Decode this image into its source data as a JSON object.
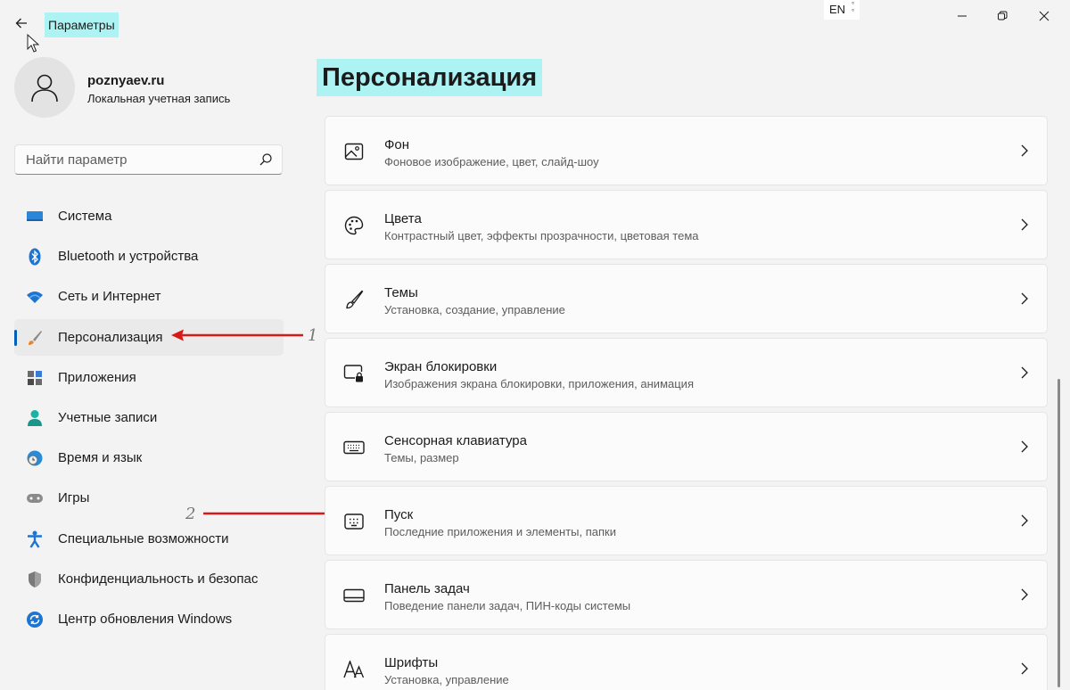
{
  "window": {
    "app_title": "Параметры",
    "lang_indicator": "EN"
  },
  "user": {
    "name": "poznyaev.ru",
    "account_type": "Локальная учетная запись"
  },
  "search": {
    "placeholder": "Найти параметр"
  },
  "sidebar": {
    "items": [
      {
        "label": "Система",
        "icon": "monitor-icon",
        "active": false
      },
      {
        "label": "Bluetooth и устройства",
        "icon": "bluetooth-icon",
        "active": false
      },
      {
        "label": "Сеть и Интернет",
        "icon": "wifi-icon",
        "active": false
      },
      {
        "label": "Персонализация",
        "icon": "brush-icon",
        "active": true
      },
      {
        "label": "Приложения",
        "icon": "apps-icon",
        "active": false
      },
      {
        "label": "Учетные записи",
        "icon": "person-icon",
        "active": false
      },
      {
        "label": "Время и язык",
        "icon": "globe-clock-icon",
        "active": false
      },
      {
        "label": "Игры",
        "icon": "gamepad-icon",
        "active": false
      },
      {
        "label": "Специальные возможности",
        "icon": "accessibility-icon",
        "active": false
      },
      {
        "label": "Конфиденциальность и безопас",
        "icon": "shield-icon",
        "active": false
      },
      {
        "label": "Центр обновления Windows",
        "icon": "update-icon",
        "active": false
      }
    ]
  },
  "annotations": {
    "marker_1": "1",
    "marker_2": "2",
    "arrow_color": "#d71919"
  },
  "main": {
    "title": "Персонализация",
    "cards": [
      {
        "title": "Фон",
        "subtitle": "Фоновое изображение, цвет, слайд-шоу",
        "icon": "image-icon"
      },
      {
        "title": "Цвета",
        "subtitle": "Контрастный цвет, эффекты прозрачности, цветовая тема",
        "icon": "palette-icon"
      },
      {
        "title": "Темы",
        "subtitle": "Установка, создание, управление",
        "icon": "brush-icon"
      },
      {
        "title": "Экран блокировки",
        "subtitle": "Изображения экрана блокировки, приложения, анимация",
        "icon": "lock-screen-icon"
      },
      {
        "title": "Сенсорная клавиатура",
        "subtitle": "Темы, размер",
        "icon": "keyboard-icon"
      },
      {
        "title": "Пуск",
        "subtitle": "Последние приложения и элементы, папки",
        "icon": "start-icon"
      },
      {
        "title": "Панель задач",
        "subtitle": "Поведение панели задач, ПИН-коды системы",
        "icon": "taskbar-icon"
      },
      {
        "title": "Шрифты",
        "subtitle": "Установка, управление",
        "icon": "fonts-icon"
      }
    ]
  },
  "colors": {
    "accent": "#005fb8",
    "highlight": "#aef3f3",
    "background": "#f3f3f3",
    "card": "#fbfbfb"
  }
}
